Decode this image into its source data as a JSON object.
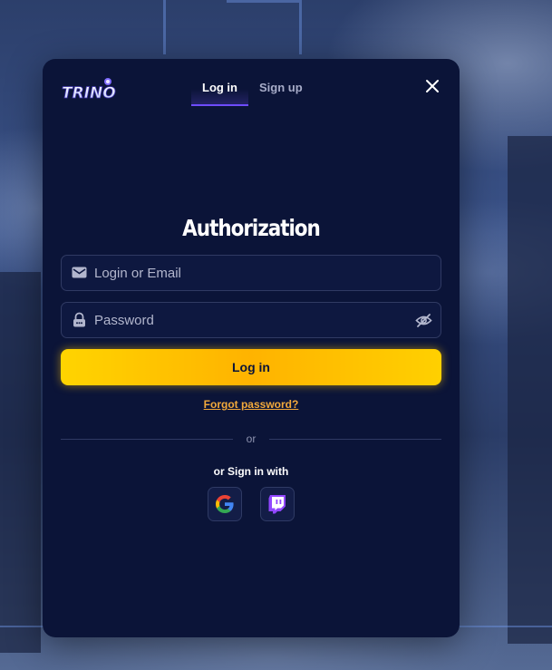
{
  "brand": {
    "logo_text": "TRINO"
  },
  "tabs": [
    {
      "label": "Log in",
      "active": true
    },
    {
      "label": "Sign up",
      "active": false
    }
  ],
  "form": {
    "title": "Authorization",
    "login": {
      "placeholder": "Login or Email",
      "value": "",
      "icon": "mail-icon"
    },
    "password": {
      "placeholder": "Password",
      "value": "",
      "icon": "lock-icon",
      "toggle_icon": "eye-off-icon"
    },
    "submit_label": "Log in",
    "forgot_label": "Forgot password?"
  },
  "divider_text": "or",
  "social": {
    "title": "or Sign in with",
    "providers": [
      {
        "name": "Google",
        "icon": "google-icon"
      },
      {
        "name": "Twitch",
        "icon": "twitch-icon"
      }
    ]
  },
  "colors": {
    "modal_bg": "#0b1438",
    "accent_yellow": "#ffc107",
    "tab_indicator": "#6e4cff",
    "link_orange": "#f2a93b",
    "twitch_purple": "#9146ff"
  }
}
